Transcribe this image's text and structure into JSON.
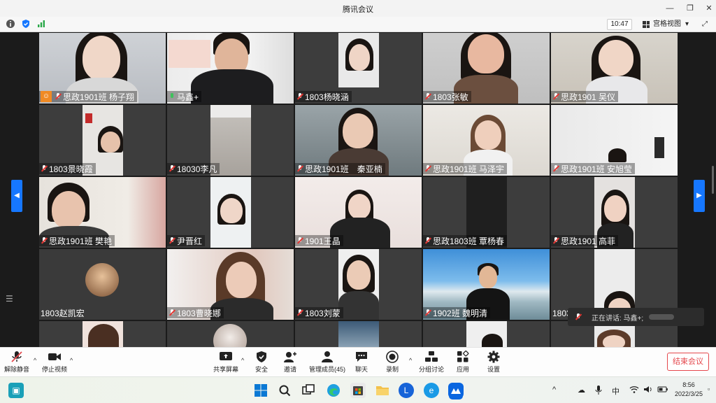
{
  "window": {
    "title": "腾讯会议",
    "minimize": "—",
    "restore": "❐",
    "close": "✕"
  },
  "toolbar": {
    "time": "10:47",
    "view_label": "宫格视图",
    "view_caret": "▾",
    "fullscreen": "⤢"
  },
  "participants": [
    {
      "name": "思政1901班 杨子翔",
      "mic": "muted",
      "host": true
    },
    {
      "name": "马鑫+",
      "mic": "on",
      "host": false
    },
    {
      "name": "1803杨晓涵",
      "mic": "muted",
      "host": false
    },
    {
      "name": "1803张敏",
      "mic": "muted",
      "host": false
    },
    {
      "name": "思政1901 吴仪",
      "mic": "muted",
      "host": false
    },
    {
      "name": "1803景晓霞",
      "mic": "muted",
      "host": false
    },
    {
      "name": "18030李凡",
      "mic": "muted",
      "host": false
    },
    {
      "name": "思政1901班　秦亚楠",
      "mic": "muted",
      "host": false
    },
    {
      "name": "思政1901班 马泽宇",
      "mic": "muted",
      "host": false
    },
    {
      "name": "思政1901班 安旭莹",
      "mic": "muted",
      "host": false
    },
    {
      "name": "思政1901班 樊艳",
      "mic": "muted",
      "host": false
    },
    {
      "name": "尹晋红",
      "mic": "muted",
      "host": false
    },
    {
      "name": "1901王晶",
      "mic": "muted",
      "host": false
    },
    {
      "name": "思政1803班 覃杨春",
      "mic": "muted",
      "host": false
    },
    {
      "name": "思政1901 高菲",
      "mic": "muted",
      "host": false
    },
    {
      "name": "1803赵凯宏",
      "mic": "none",
      "host": false
    },
    {
      "name": "1803曹晓娜",
      "mic": "muted",
      "host": false
    },
    {
      "name": "1803刘蒙",
      "mic": "muted",
      "host": false
    },
    {
      "name": "1902班 魏明清",
      "mic": "muted",
      "host": false
    },
    {
      "name": "1803刘洋梦",
      "mic": "none",
      "host": false
    }
  ],
  "speaking": {
    "label": "正在讲话: 马鑫+;"
  },
  "controls": {
    "unmute": "解除静音",
    "stop_video": "停止视频",
    "share_screen": "共享屏幕",
    "security": "安全",
    "invite": "邀请",
    "manage_members": "管理成员(45)",
    "chat": "聊天",
    "record": "录制",
    "breakout": "分组讨论",
    "apps": "应用",
    "settings": "设置",
    "end_meeting": "结束会议",
    "caret": "^"
  },
  "taskbar": {
    "ime": "中",
    "time": "8:56",
    "date": "2022/3/25",
    "chevron": "^"
  },
  "colors": {
    "accent": "#1677ff",
    "danger": "#e5484d",
    "host_badge": "#f08a24",
    "unmuted_mic": "#3ec25c"
  }
}
